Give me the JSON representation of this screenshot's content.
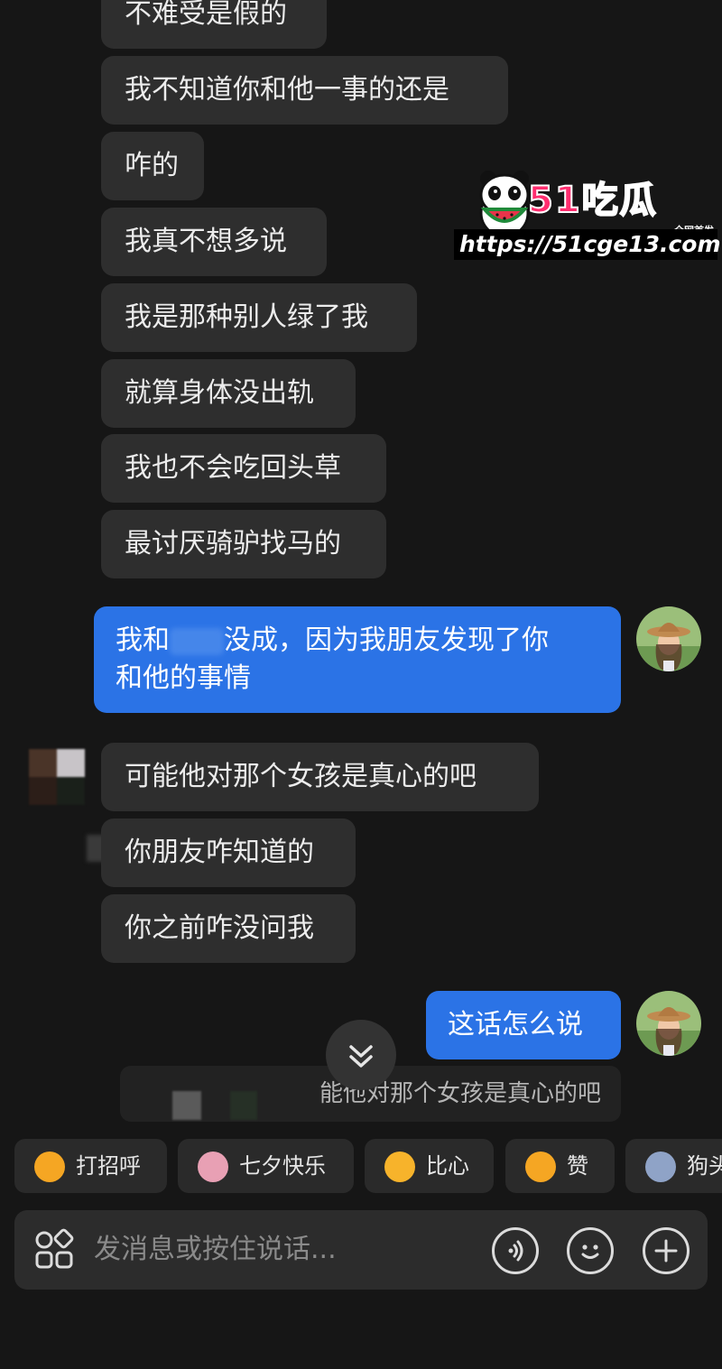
{
  "watermark": {
    "logo": "51吃瓜",
    "first_release": "全网首发",
    "url": "https://51cge13.com"
  },
  "messages": [
    {
      "sender": "them",
      "text": "不难受是假的"
    },
    {
      "sender": "them",
      "text": "我不知道你和他一事的还是"
    },
    {
      "sender": "them",
      "text": "咋的"
    },
    {
      "sender": "them",
      "text": "我真不想多说"
    },
    {
      "sender": "them",
      "text": "我是那种别人绿了我"
    },
    {
      "sender": "them",
      "text": "就算身体没出轨"
    },
    {
      "sender": "them",
      "text": "我也不会吃回头草"
    },
    {
      "sender": "them",
      "text": "最讨厌骑驴找马的"
    },
    {
      "sender": "me",
      "line1_part1": "我和",
      "line1_part2": "没成，因为我朋友发现了你",
      "line2": "和他的事情"
    },
    {
      "sender": "them",
      "text": "可能他对那个女孩是真心的吧"
    },
    {
      "sender": "them",
      "text": "你朋友咋知道的"
    },
    {
      "sender": "them",
      "text": "你之前咋没问我"
    },
    {
      "sender": "me",
      "text": "这话怎么说"
    }
  ],
  "scroll_button": {
    "icon": "double-chevron-down"
  },
  "quote_preview": {
    "text": "能他对那个女孩是真心的吧"
  },
  "quick_replies": [
    {
      "label": "打招呼",
      "icon": "wave-emoji",
      "color": "#f5a623"
    },
    {
      "label": "七夕快乐",
      "icon": "dove-heart",
      "color": "#e8a0b4"
    },
    {
      "label": "比心",
      "icon": "finger-heart-emoji",
      "color": "#f7b32b"
    },
    {
      "label": "赞",
      "icon": "thumbs-up-emoji",
      "color": "#f5a623"
    },
    {
      "label": "狗头",
      "icon": "dog-head-emoji",
      "color": "#8fa3c7"
    }
  ],
  "input": {
    "placeholder": "发消息或按住说话...",
    "apps_icon": "apps-grid-icon",
    "voice_icon": "voice-icon",
    "emoji_icon": "emoji-icon",
    "plus_icon": "plus-icon"
  },
  "colors": {
    "background": "#161616",
    "incoming_bubble": "#2e2e2e",
    "outgoing_bubble": "#2b73e6",
    "watermark_pink": "#ff2d6f"
  }
}
